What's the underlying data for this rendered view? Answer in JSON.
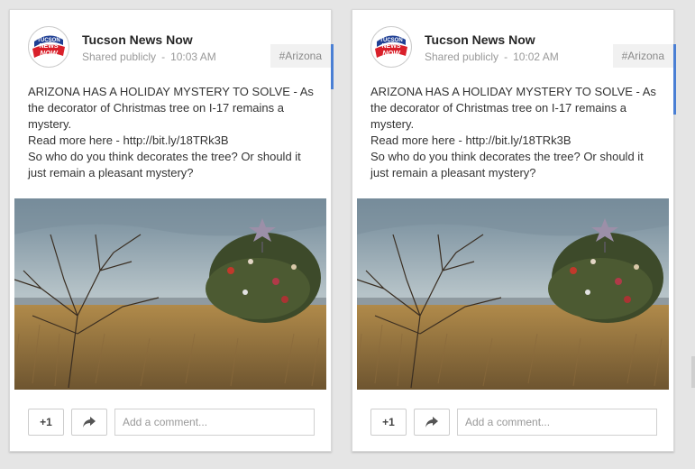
{
  "posts": [
    {
      "author": "Tucson News Now",
      "visibility": "Shared publicly",
      "separator": "-",
      "time": "10:03 AM",
      "hashtag": "#Arizona",
      "lines": [
        "ARIZONA HAS A HOLIDAY MYSTERY TO SOLVE - As the decorator of Christmas tree on I-17 remains a mystery.",
        "Read more here - http://bit.ly/18TRk3B",
        "So who do you think decorates the tree? Or should it just remain a pleasant mystery?"
      ],
      "plus_label": "+1",
      "share_icon": "share-arrow-icon",
      "comment_placeholder": "Add a comment..."
    },
    {
      "author": "Tucson News Now",
      "visibility": "Shared publicly",
      "separator": "-",
      "time": "10:02 AM",
      "hashtag": "#Arizona",
      "lines": [
        "ARIZONA HAS A HOLIDAY MYSTERY TO SOLVE - As the decorator of Christmas tree on I-17 remains a mystery.",
        "Read more here - http://bit.ly/18TRk3B",
        "So who do you think decorates the tree? Or should it just remain a pleasant mystery?"
      ],
      "plus_label": "+1",
      "share_icon": "share-arrow-icon",
      "comment_placeholder": "Add a comment..."
    }
  ],
  "logo": {
    "line1": "TUCSON",
    "line2": "NEWS",
    "line3": "NOW"
  },
  "colors": {
    "accent": "#4a7fd4",
    "logo_red": "#d9202a",
    "logo_blue": "#1f3f94"
  }
}
